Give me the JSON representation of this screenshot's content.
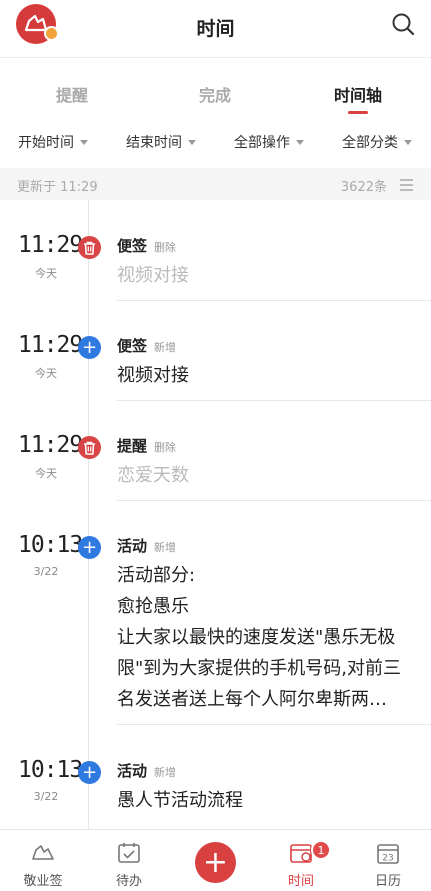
{
  "header": {
    "title": "时间"
  },
  "tabs": [
    {
      "label": "提醒"
    },
    {
      "label": "完成"
    },
    {
      "label": "时间轴"
    }
  ],
  "filters": [
    {
      "label": "开始时间"
    },
    {
      "label": "结束时间"
    },
    {
      "label": "全部操作"
    },
    {
      "label": "全部分类"
    }
  ],
  "status": {
    "updated": "更新于 11:29",
    "count": "3622条"
  },
  "entries": [
    {
      "time": "11:29",
      "date": "今天",
      "kind": "便签",
      "action": "删除",
      "text": "视频对接",
      "type": "delete"
    },
    {
      "time": "11:29",
      "date": "今天",
      "kind": "便签",
      "action": "新增",
      "text": "视频对接",
      "type": "add"
    },
    {
      "time": "11:29",
      "date": "今天",
      "kind": "提醒",
      "action": "删除",
      "text": "恋爱天数",
      "type": "delete"
    },
    {
      "time": "10:13",
      "date": "3/22",
      "kind": "活动",
      "action": "新增",
      "type": "add",
      "lines": [
        "活动部分:",
        "愈抢愚乐",
        "让大家以最快的速度发送\"愚乐无极",
        "限\"到为大家提供的手机号码,对前三",
        "名发送者送上每个人阿尔卑斯两…"
      ]
    },
    {
      "time": "10:13",
      "date": "3/22",
      "kind": "活动",
      "action": "新增",
      "text": "愚人节活动流程",
      "type": "add"
    }
  ],
  "nav": [
    {
      "label": "敬业签"
    },
    {
      "label": "待办"
    },
    {
      "label": ""
    },
    {
      "label": "时间",
      "badge": "1"
    },
    {
      "label": "日历"
    }
  ],
  "colors": {
    "accent": "#d94040",
    "add": "#2f79e0",
    "delete": "#d94444"
  }
}
